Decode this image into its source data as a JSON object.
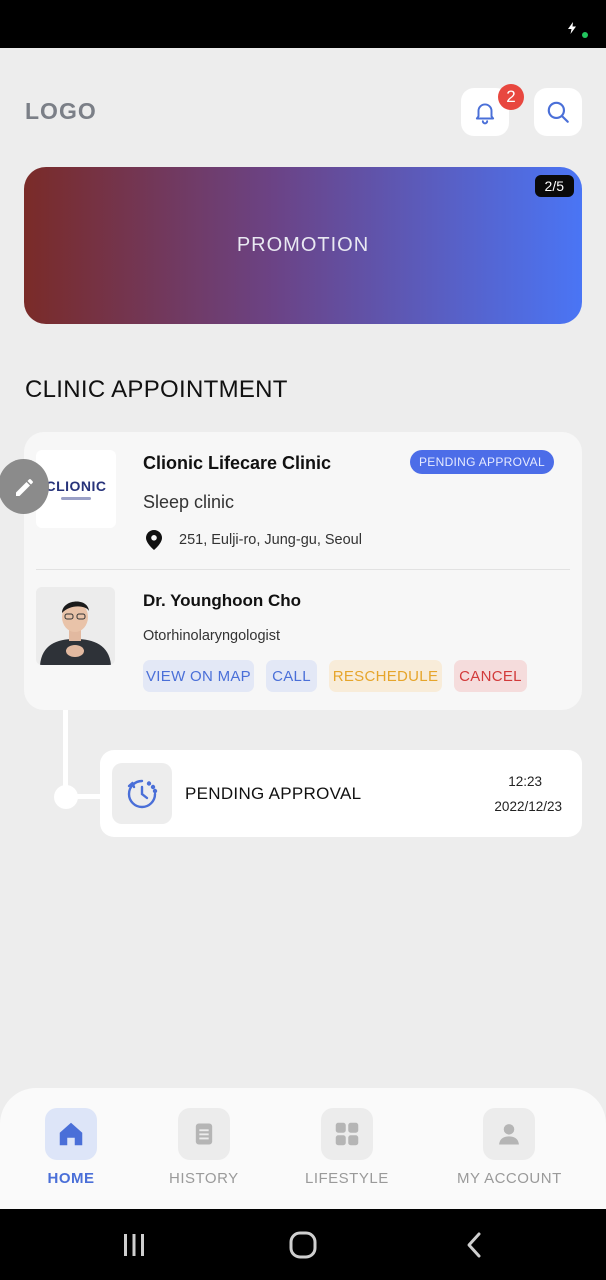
{
  "header": {
    "logo_text": "LOGO",
    "notification_count": "2"
  },
  "promotion": {
    "text": "PROMOTION",
    "page_indicator": "2/5"
  },
  "section_title": "CLINIC APPOINTMENT",
  "appointment": {
    "clinic_logo_text": "CLIONIC",
    "clinic_name": "Clionic Lifecare Clinic",
    "status": "PENDING APPROVAL",
    "clinic_type": "Sleep clinic",
    "address": "251, Eulji-ro, Jung-gu, Seoul",
    "doctor_name": "Dr. Younghoon Cho",
    "specialty": "Otorhinolaryngologist",
    "actions": {
      "view_map": "VIEW ON MAP",
      "call": "CALL",
      "reschedule": "RESCHEDULE",
      "cancel": "CANCEL"
    }
  },
  "timeline": {
    "label": "PENDING APPROVAL",
    "time": "12:23",
    "date": "2022/12/23"
  },
  "bottom_nav": {
    "items": [
      {
        "label": "HOME",
        "icon": "home-icon",
        "active": true
      },
      {
        "label": "HISTORY",
        "icon": "document-icon",
        "active": false
      },
      {
        "label": "LIFESTYLE",
        "icon": "grid-icon",
        "active": false
      },
      {
        "label": "MY ACCOUNT",
        "icon": "user-icon",
        "active": false
      }
    ]
  },
  "colors": {
    "accent": "#4a6fd8",
    "pending": "#4c6de8",
    "reschedule": "#e6a52b",
    "cancel": "#d23a3a",
    "badge": "#e8473f"
  }
}
